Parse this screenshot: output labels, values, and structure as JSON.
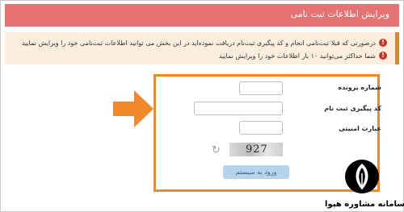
{
  "header": {
    "title": "ویرایش اطلاعات ثبت نامی"
  },
  "notices": [
    "درصورتی که قبلا ثبت‌نامی انجام و کد پیگیری ثبت‌نام دریافت نموده‌اید در این بخش می توانید اطلاعات ثبت‌نامی خود را ویرایش نمایید",
    "شما حداکثر می‌توانید ۱۰ بار اطلاعات خود را ویرایش نمایید"
  ],
  "form": {
    "file_number_label": "شماره پرونده",
    "tracking_code_label": "کد پیگیری ثبت نام",
    "security_phrase_label": "عبارت امنیتی",
    "captcha_text": "927",
    "login_button": "ورود به سیستم"
  },
  "watermark": {
    "text": "سامانه مشاوره هپوا"
  },
  "colors": {
    "header": "#e57373",
    "arrow": "#f1892b",
    "form_border": "#f1892b",
    "notice_bg": "#fbeede",
    "alert_icon": "#c0392b",
    "button": "#b5d3ec"
  },
  "icons": {
    "alert": "alert-circle-icon",
    "refresh": "refresh-icon",
    "arrow": "arrow-right-icon"
  }
}
